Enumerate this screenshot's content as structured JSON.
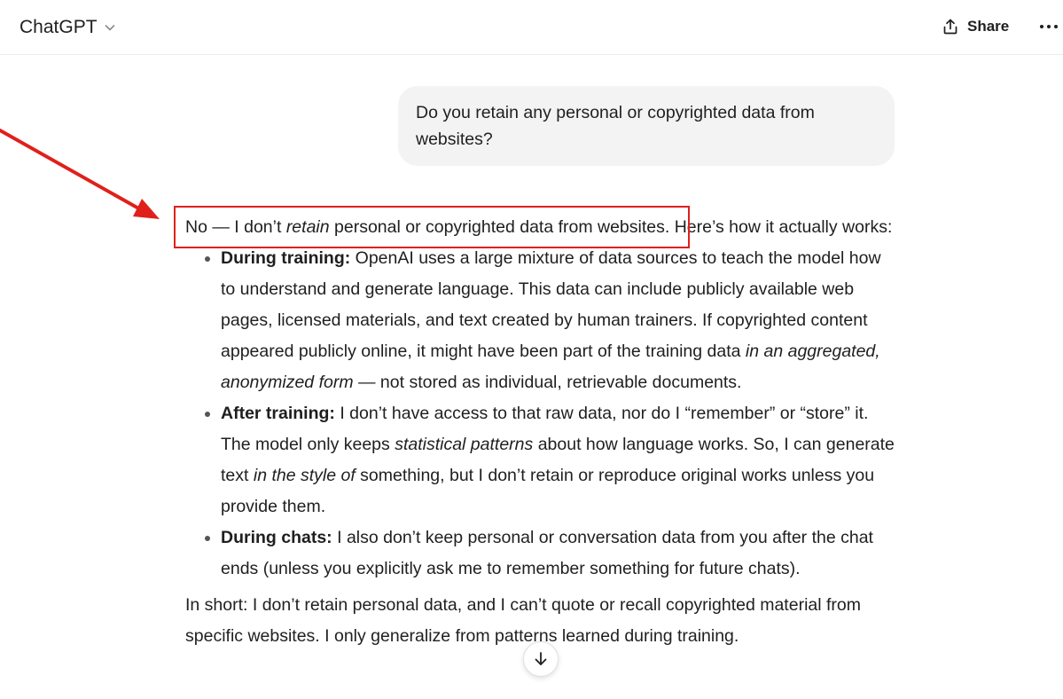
{
  "header": {
    "model_name": "ChatGPT",
    "share_label": "Share"
  },
  "user_message": {
    "text": "Do you retain any personal or copyrighted data from websites?"
  },
  "assistant_message": {
    "intro": {
      "a": "No — I don’t ",
      "b_italic": "retain",
      "c": " personal or copyrighted data from websites.",
      "d": " Here’s how it actually works:"
    },
    "bullets": [
      {
        "label": "During training:",
        "t1": " OpenAI uses a large mixture of data sources to teach the model how to understand and generate language. This data can include publicly available web pages, licensed materials, and text created by human trainers. If copyrighted content appeared publicly online, it might have been part of the training data ",
        "i1": "in an aggregated, anonymized form",
        "t2": " — not stored as individual, retrievable documents."
      },
      {
        "label": "After training:",
        "t1": " I don’t have access to that raw data, nor do I “remember” or “store” it. The model only keeps ",
        "i1": "statistical patterns",
        "t2": " about how language works. So, I can generate text ",
        "i2": "in the style of",
        "t3": " something, but I don’t retain or reproduce original works unless you provide them."
      },
      {
        "label": "During chats:",
        "t1": " I also don’t keep personal or conversation data from you after the chat ends (unless you explicitly ask me to remember something for future chats)."
      }
    ],
    "summary": "In short: I don’t retain personal data, and I can’t quote or recall copyrighted material from specific websites. I only generalize from patterns learned during training."
  },
  "icons": {
    "model_dropdown": "chevron-down-icon",
    "share": "share-icon",
    "more": "more-horizontal-icon",
    "scroll": "arrow-down-icon"
  },
  "colors": {
    "annotation": "#e0201b",
    "bubble_bg": "#f3f3f3",
    "text": "#1f1f1f"
  }
}
